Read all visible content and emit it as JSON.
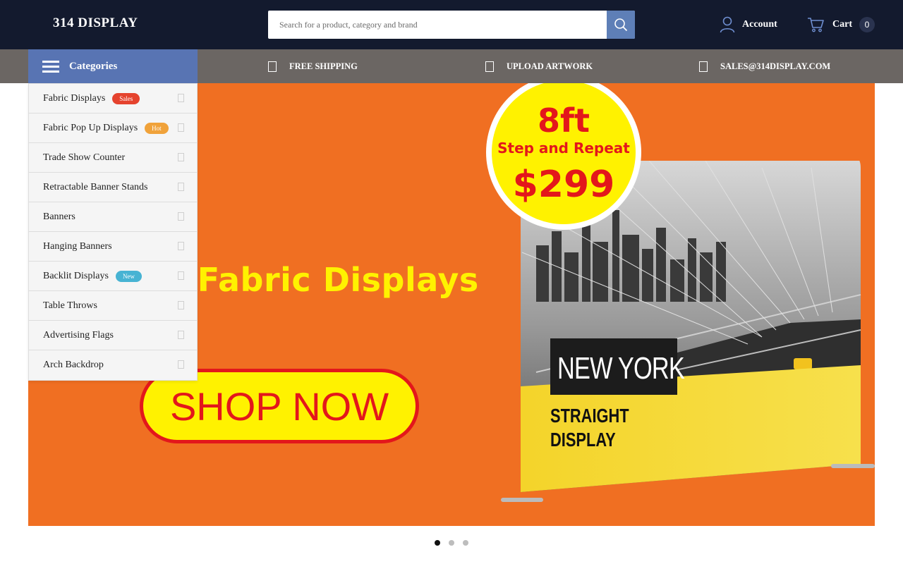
{
  "header": {
    "logo": "314 DISPLAY",
    "search_placeholder": "Search for a product, category and brand",
    "account_label": "Account",
    "cart_label": "Cart",
    "cart_count": "0"
  },
  "navbar": {
    "categories_label": "Categories",
    "items": [
      {
        "label": "FREE SHIPPING"
      },
      {
        "label": "UPLOAD ARTWORK"
      },
      {
        "label": "SALES@314DISPLAY.COM"
      }
    ]
  },
  "categories": [
    {
      "label": "Fabric Displays",
      "tag": "Sales",
      "tag_color": "#e5432e"
    },
    {
      "label": "Fabric Pop Up Displays",
      "tag": "Hot",
      "tag_color": "#f0a23a"
    },
    {
      "label": "Trade Show Counter"
    },
    {
      "label": "Retractable Banner Stands"
    },
    {
      "label": "Banners"
    },
    {
      "label": "Hanging Banners"
    },
    {
      "label": "Backlit Displays",
      "tag": "New",
      "tag_color": "#47b3d3"
    },
    {
      "label": "Table Throws"
    },
    {
      "label": "Advertising Flags"
    },
    {
      "label": "Arch Backdrop"
    }
  ],
  "hero": {
    "title": "n Fabric Displays",
    "cta": "SHOP NOW",
    "badge_line1": "8ft",
    "badge_line2": "Step and Repeat",
    "badge_line3": "$299",
    "display_line1": "NEW YORK",
    "display_line2": "STRAIGHT",
    "display_line3": "DISPLAY",
    "background_color": "#f06f22"
  },
  "slider": {
    "slides": 3,
    "active": 1
  }
}
